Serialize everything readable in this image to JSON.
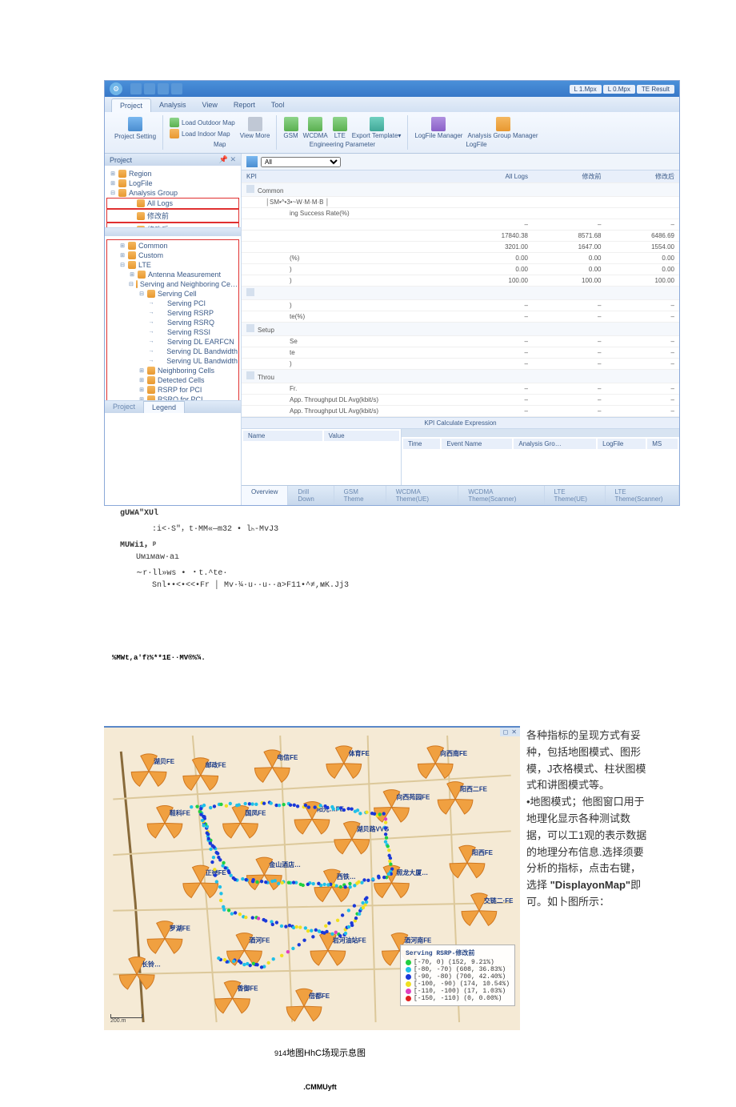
{
  "titlebar": {
    "right": [
      "L 1.Mpx",
      "L 0.Mpx",
      "TE Result"
    ]
  },
  "ribbon": {
    "tabs": [
      "Project",
      "Analysis",
      "View",
      "Report",
      "Tool"
    ],
    "active_tab": "Project",
    "groups": {
      "project_setting": {
        "label": "Project Setting",
        "item": "⬛"
      },
      "map": {
        "label": "Map",
        "outdoor": "Load Outdoor Map",
        "indoor": "Load Indoor Map",
        "view_more": "View More"
      },
      "eng_param": {
        "label": "Engineering Parameter",
        "gsm": "GSM",
        "wcdma": "WCDMA",
        "lte": "LTE",
        "export": "Export Template▾"
      },
      "logfile": {
        "label": "LogFile",
        "mgr": "LogFile Manager",
        "agmgr": "Analysis Group Manager"
      }
    }
  },
  "sidebar": {
    "panel_title": "Project",
    "tree_top": [
      {
        "label": "Region",
        "icon": "globe",
        "exp": "⊞"
      },
      {
        "label": "LogFile",
        "icon": "folder",
        "exp": "⊞"
      },
      {
        "label": "Analysis Group",
        "icon": "folder",
        "exp": "⊟"
      },
      {
        "label": "All Logs",
        "icon": "page",
        "lvl": 2,
        "hl": true
      },
      {
        "label": "修改前",
        "icon": "page",
        "lvl": 2,
        "hl": true
      },
      {
        "label": "修改后",
        "icon": "page",
        "lvl": 2,
        "hl": true
      }
    ],
    "tree_bottom": [
      {
        "label": "Common",
        "exp": "⊞",
        "lvl": 1
      },
      {
        "label": "Custom",
        "exp": "⊞",
        "lvl": 1
      },
      {
        "label": "LTE",
        "exp": "⊟",
        "lvl": 1
      },
      {
        "label": "Antenna Measurement",
        "exp": "⊞",
        "lvl": 2
      },
      {
        "label": "Serving and Neighboring Ce…",
        "exp": "⊟",
        "lvl": 2
      },
      {
        "label": "Serving Cell",
        "exp": "⊟",
        "lvl": 3
      },
      {
        "label": "Serving PCI",
        "arrow": true,
        "lvl": 4
      },
      {
        "label": "Serving RSRP",
        "arrow": true,
        "lvl": 4
      },
      {
        "label": "Serving RSRQ",
        "arrow": true,
        "lvl": 4
      },
      {
        "label": "Serving RSSI",
        "arrow": true,
        "lvl": 4
      },
      {
        "label": "Serving DL EARFCN",
        "arrow": true,
        "lvl": 4
      },
      {
        "label": "Serving DL Bandwidth",
        "arrow": true,
        "lvl": 4
      },
      {
        "label": "Serving UL Bandwidth",
        "arrow": true,
        "lvl": 4
      },
      {
        "label": "Neighboring Cells",
        "exp": "⊞",
        "lvl": 3
      },
      {
        "label": "Detected Cells",
        "exp": "⊞",
        "lvl": 3
      },
      {
        "label": "RSRP for PCI",
        "exp": "⊞",
        "lvl": 3
      },
      {
        "label": "RSRQ for PCI",
        "exp": "⊞",
        "lvl": 3
      }
    ],
    "bottom_tabs": [
      "Project",
      "Legend"
    ]
  },
  "kpi": {
    "filter_all": "All",
    "headers": [
      "KPI",
      "All Logs",
      "修改前",
      "修改后"
    ],
    "crumb": "│SM•^•3•~W·M·M·B │",
    "group1": "Common",
    "row1_label": "ing Success Rate(%)",
    "rows_blank": [
      {
        "k": "",
        "a": "–",
        "b": "–",
        "c": "–"
      },
      {
        "k": "",
        "a": "17840.38",
        "b": "8571.68",
        "c": "6486.69"
      },
      {
        "k": "",
        "a": "3201.00",
        "b": "1647.00",
        "c": "1554.00"
      },
      {
        "k": "(%)",
        "a": "0.00",
        "b": "0.00",
        "c": "0.00"
      },
      {
        "k": ")",
        "a": "0.00",
        "b": "0.00",
        "c": "0.00"
      },
      {
        "k": ")",
        "a": "100.00",
        "b": "100.00",
        "c": "100.00"
      }
    ],
    "group_setup": "Setup",
    "setup_rows": [
      {
        "k": ")",
        "a": "–",
        "b": "–",
        "c": "–"
      },
      {
        "k": "te(%)",
        "a": "–",
        "b": "–",
        "c": "–"
      }
    ],
    "row_sx": [
      {
        "k": "Se",
        "a": "–",
        "b": "–",
        "c": "–"
      },
      {
        "k": "te",
        "a": "–",
        "b": "–",
        "c": "–"
      },
      {
        "k": ")",
        "a": "–",
        "b": "–",
        "c": "–"
      }
    ],
    "group_thru": "Throu",
    "thru_rows": [
      {
        "k": "Fr.",
        "a": "–",
        "b": "–",
        "c": "–"
      },
      {
        "k": "App. Throughput DL Avg(kbit/s)",
        "a": "–",
        "b": "–",
        "c": "–"
      },
      {
        "k": "App. Throughput UL Avg(kbit/s)",
        "a": "–",
        "b": "–",
        "c": "–"
      }
    ],
    "expr_bar": "KPI Calculate Expression",
    "lower_left_hdr": [
      "Name",
      "Value"
    ],
    "lower_right_hdr": [
      "Time",
      "Event Name",
      "Analysis Gro…",
      "LogFile",
      "MS"
    ]
  },
  "theme_tabs": [
    "Overview",
    "Drill Down",
    "GSM Theme",
    "WCDMA Theme(UE)",
    "WCDMA Theme(Scanner)",
    "LTE Theme(UE)",
    "LTE Theme(Scanner)"
  ],
  "under_text": {
    "l1": "gUWA\"XUl",
    "l2": ":i<·S\"，t·MM«—m32 • lₕ-MvJ3",
    "l3": "MUWi1，ᵖ",
    "l4": "Uмıмaw·aı",
    "l5": "∼r·ll»ws • ・t.^te·",
    "l6": "Snl••<•<<•Fr │ Mv·¼·u··u··a>F11•^≠,ᴍK.Jj3"
  },
  "map": {
    "caption_top": "%MWt,a'f≀%**1E··MV®%¼.",
    "controls": [
      "◻",
      "✕"
    ],
    "scale": "200.m",
    "sites": [
      "邮政FE",
      "电信FE",
      "体育FE",
      "鞋科FE",
      "国凤FE",
      "阳光…FE",
      "正德FE",
      "金山酒店…",
      "西铁…",
      "照龙大厦…",
      "罗湖FE",
      "酒河FE",
      "岩河油站FE",
      "酒河南FE",
      "香御FE",
      "倍都FE",
      "湖贝FE",
      "阳西二FE",
      "阳西FE",
      "交链二·FE",
      "向西苑园FE",
      "向西南FE",
      "湖贝路VVG",
      "长铃…"
    ],
    "legend_title": "Serving RSRP-修改前",
    "legend": [
      {
        "c": "#20d040",
        "t": "[-70, 0) (152, 9.21%)"
      },
      {
        "c": "#20c0e8",
        "t": "[-80, -70) (608, 36.83%)"
      },
      {
        "c": "#1a38d8",
        "t": "[-90, -80) (700, 42.40%)"
      },
      {
        "c": "#f0e020",
        "t": "[-100, -90) (174, 10.54%)"
      },
      {
        "c": "#e040c0",
        "t": "[-110, -100) (17, 1.03%)"
      },
      {
        "c": "#e02020",
        "t": "[-150, -110) (0, 0.00%)"
      }
    ]
  },
  "side_text": {
    "p1": "各种指标的呈现方式有妥种，包括地图模式、图形模，J衣格模式、柱状图模式和讲图模式等。",
    "p2_lead": "•地图模式；",
    "p2": "他图窗口用于地理化显示各种测试数据，可以工1观的表示数据的地理分布信息.选择须要分析的指标，点击右键，选择",
    "quote": "\"DisplayonMap\"",
    "p3": "即可。如卜图所示："
  },
  "bottom_caption_prefix": "914",
  "bottom_caption": "地图HhC场现示息图",
  "footer": ".CMMUyft"
}
